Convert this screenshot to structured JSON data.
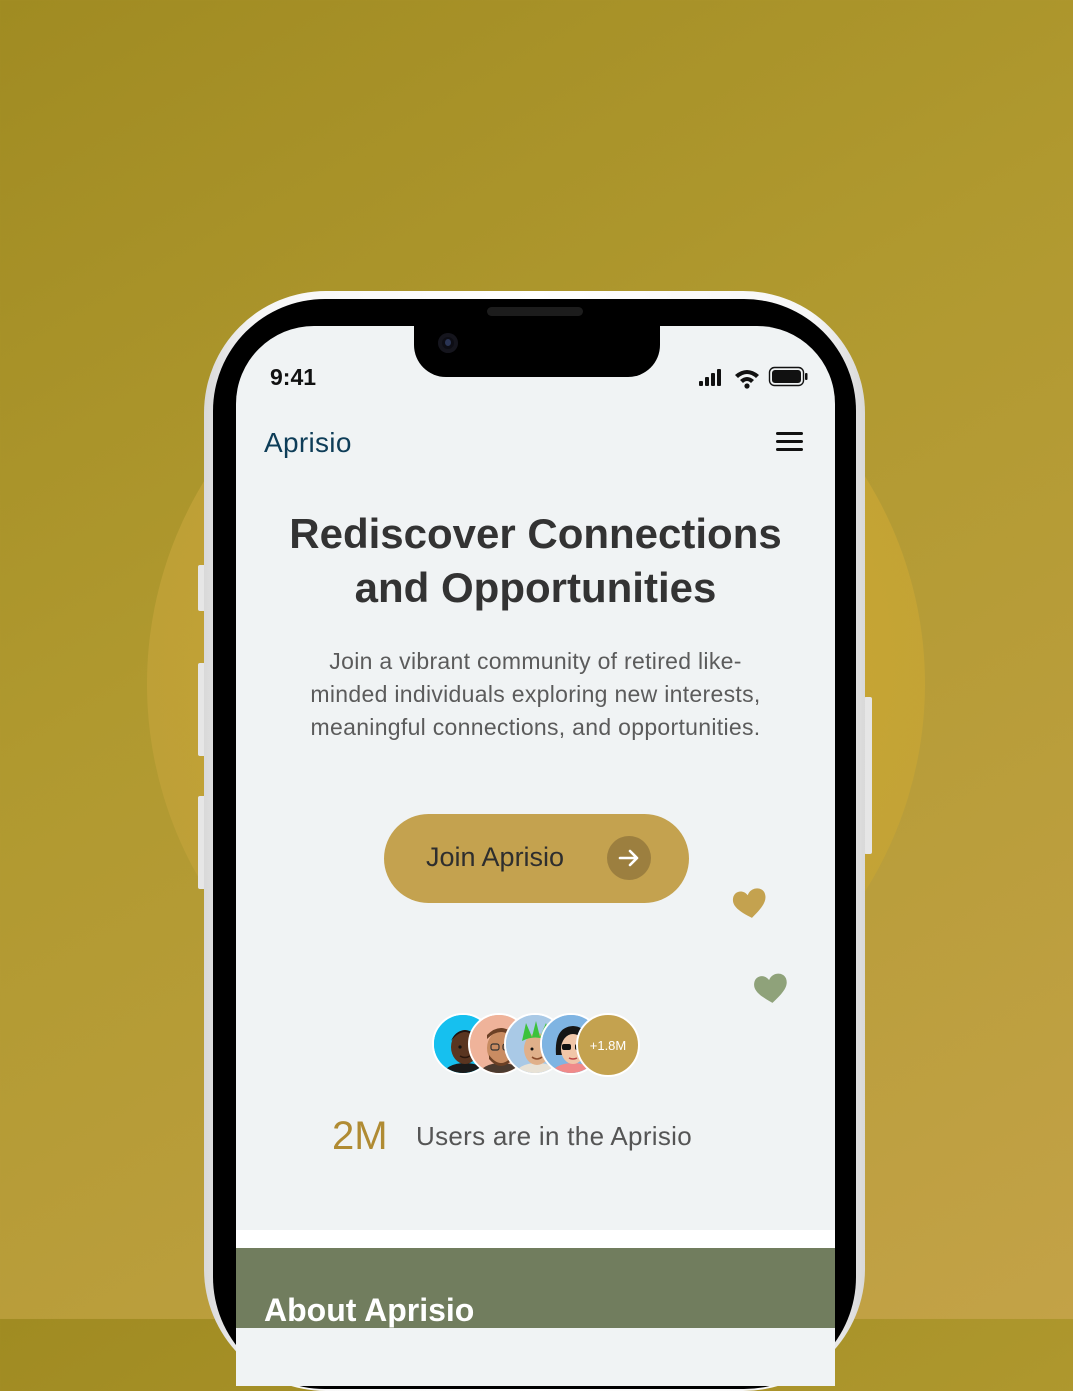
{
  "status_bar": {
    "time": "9:41"
  },
  "header": {
    "brand": "Aprisio"
  },
  "hero": {
    "title_line1": "Rediscover Connections",
    "title_line2": "and Opportunities",
    "subtitle_line1": "Join a vibrant community of retired like-",
    "subtitle_line2": "minded individuals exploring new interests,",
    "subtitle_line3": "meaningful connections, and opportunities."
  },
  "cta": {
    "label": "Join Aprisio",
    "icon": "arrow-right-icon"
  },
  "social_proof": {
    "extra_count": "+1.8M",
    "stat_number": "2M",
    "stat_label": "Users are in the Aprisio"
  },
  "about": {
    "title": "About Aprisio"
  },
  "colors": {
    "accent": "#c4a24f",
    "brand": "#0e3d58",
    "about_bg": "#717d5e",
    "heart_gold": "#c4a24f",
    "heart_sage": "#8fa27a"
  }
}
